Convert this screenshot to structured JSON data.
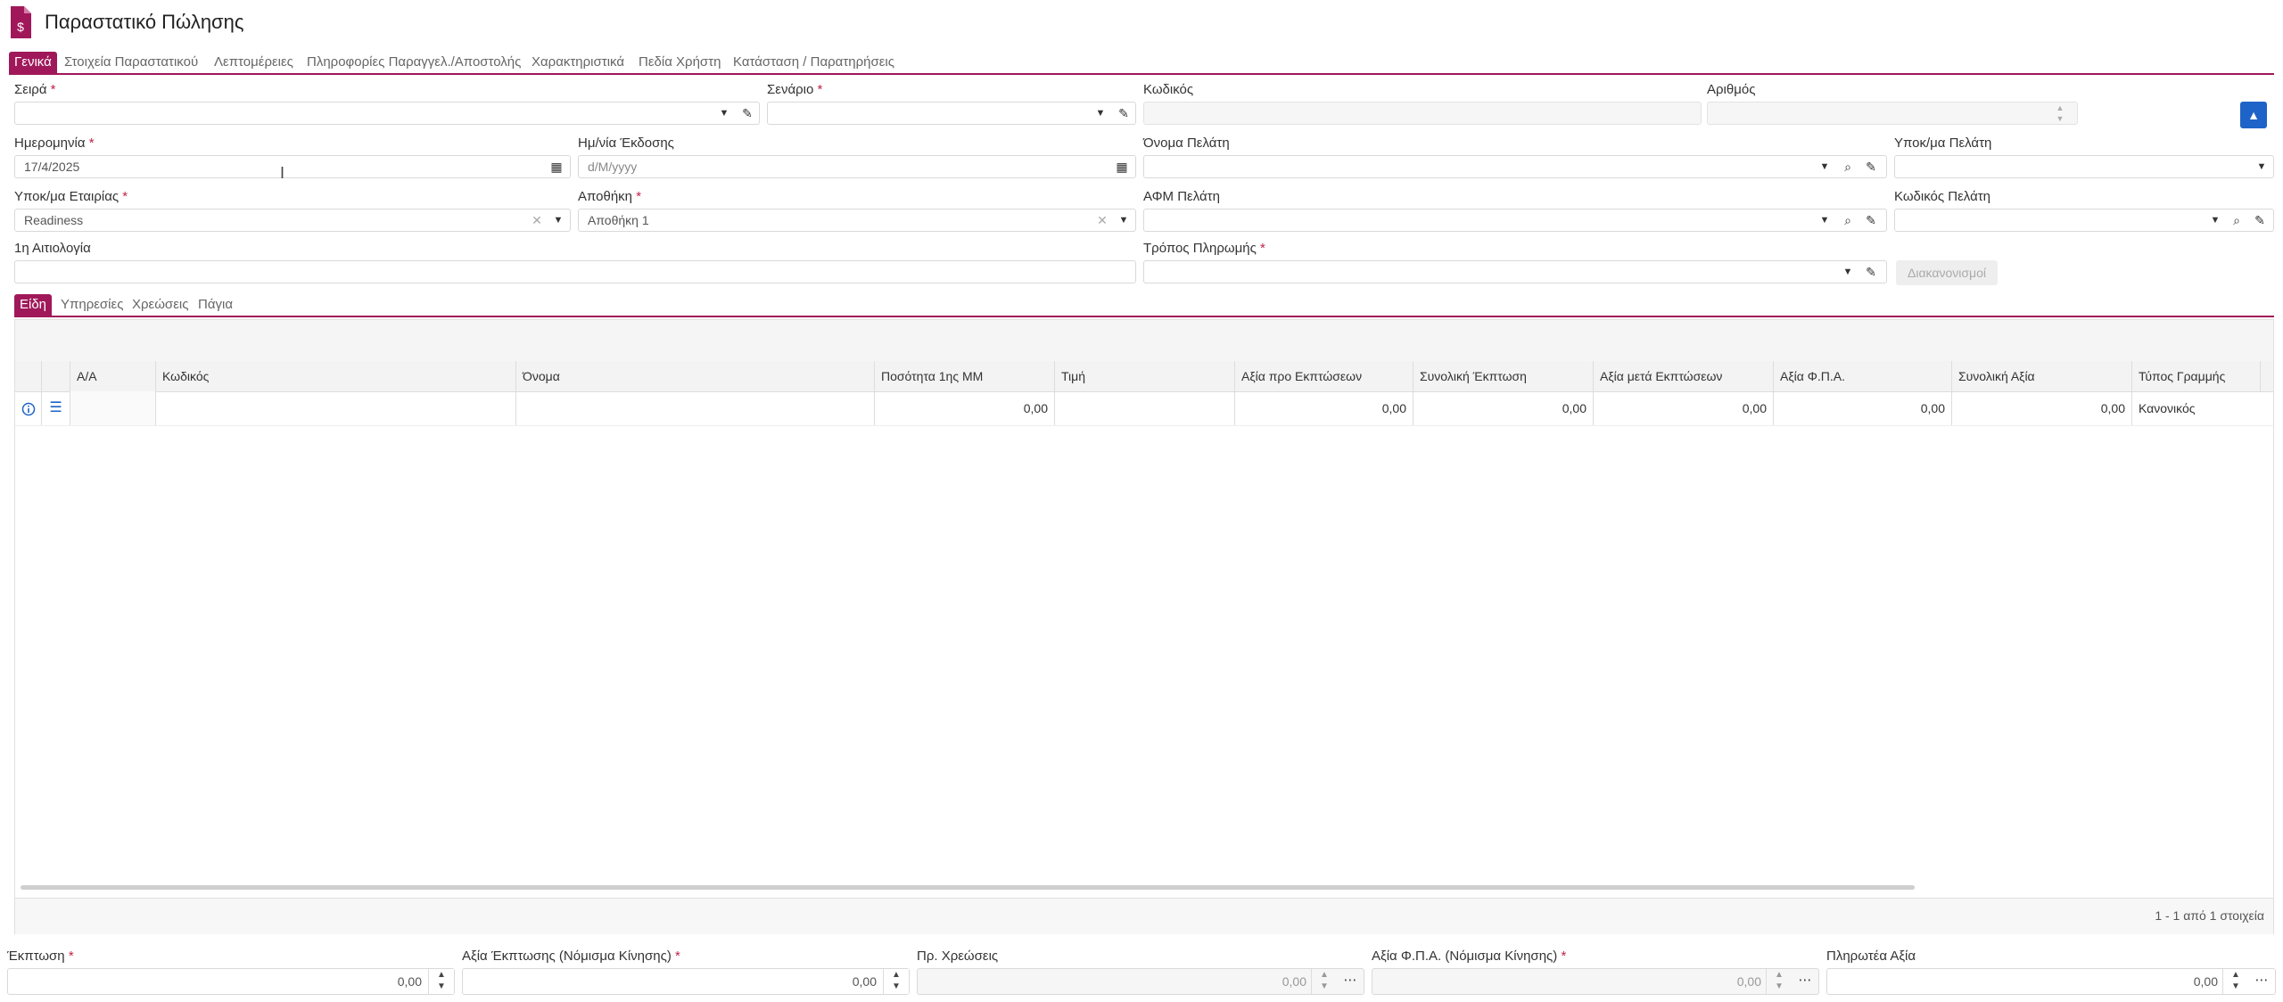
{
  "header": {
    "title": "Παραστατικό Πώλησης",
    "icon": "invoice-dollar-icon"
  },
  "tabs": [
    {
      "label": "Γενικά",
      "active": true
    },
    {
      "label": "Στοιχεία Παραστατικού"
    },
    {
      "label": "Λεπτομέρειες"
    },
    {
      "label": "Πληροφορίες Παραγγελ./Αποστολής"
    },
    {
      "label": "Χαρακτηριστικά"
    },
    {
      "label": "Πεδία Χρήστη"
    },
    {
      "label": "Κατάσταση / Παρατηρήσεις"
    }
  ],
  "form": {
    "seira": {
      "label": "Σειρά",
      "value": ""
    },
    "senario": {
      "label": "Σενάριο",
      "value": ""
    },
    "kodikos": {
      "label": "Κωδικός",
      "value": ""
    },
    "arithmos": {
      "label": "Αριθμός",
      "value": ""
    },
    "imerominia": {
      "label": "Ημερομηνία",
      "value": "17/4/2025"
    },
    "ekdosi": {
      "label": "Ημ/νία Έκδοσης",
      "placeholder": "d/M/yyyy"
    },
    "onoma_pelati": {
      "label": "Όνομα Πελάτη",
      "value": ""
    },
    "ypok_pelati": {
      "label": "Υποκ/μα Πελάτη",
      "value": ""
    },
    "ypok_etairias": {
      "label": "Υποκ/μα Εταιρίας",
      "value": "Readiness"
    },
    "apothiki": {
      "label": "Αποθήκη",
      "value": "Αποθήκη 1"
    },
    "afm_pelati": {
      "label": "ΑΦΜ Πελάτη",
      "value": ""
    },
    "kodikos_pelati": {
      "label": "Κωδικός Πελάτη",
      "value": ""
    },
    "aitiologia": {
      "label": "1η Αιτιολογία",
      "value": ""
    },
    "tropos_pliromis": {
      "label": "Τρόπος Πληρωμής",
      "value": ""
    },
    "diakanonismoi": "Διακανονισμοί",
    "required_mark": "*"
  },
  "subtabs": [
    {
      "label": "Είδη",
      "active": true
    },
    {
      "label": "Υπηρεσίες"
    },
    {
      "label": "Χρεώσεις"
    },
    {
      "label": "Πάγια"
    }
  ],
  "grid": {
    "columns": [
      "Α/Α",
      "Κωδικός",
      "Όνομα",
      "Ποσότητα 1ης ΜΜ",
      "Τιμή",
      "Αξία προ Εκπτώσεων",
      "Συνολική Έκπτωση",
      "Αξία μετά Εκπτώσεων",
      "Αξία Φ.Π.Α.",
      "Συνολική Αξία",
      "Τύπος Γραμμής"
    ],
    "rows": [
      {
        "aa": "",
        "kodikos": "",
        "onoma": "",
        "posotita": "0,00",
        "timi": "",
        "axia_pro": "0,00",
        "ekptosi": "0,00",
        "axia_meta": "0,00",
        "fpa": "0,00",
        "synoliki": "0,00",
        "typos": "Κανονικός"
      }
    ],
    "pager": "1 - 1 από 1 στοιχεία"
  },
  "totals": [
    {
      "label": "Έκπτωση",
      "required": true,
      "value": "0,00"
    },
    {
      "label": "Αξία Έκπτωσης (Νόμισμα Κίνησης)",
      "required": true,
      "value": "0,00"
    },
    {
      "label": "Πρ. Χρεώσεις",
      "required": false,
      "value": "0,00"
    },
    {
      "label": "Αξία Φ.Π.Α. (Νόμισμα Κίνησης)",
      "required": true,
      "value": "0,00"
    },
    {
      "label": "Πληρωτέα Αξία",
      "required": false,
      "value": "0,00"
    }
  ],
  "colors": {
    "accent": "#a0185a",
    "primary_button": "#1e63c8"
  }
}
